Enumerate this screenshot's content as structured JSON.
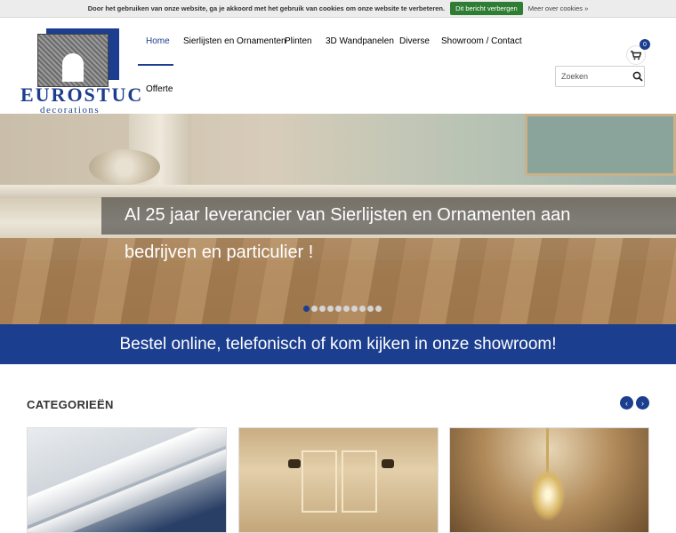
{
  "cookie": {
    "message": "Door het gebruiken van onze website, ga je akkoord met het gebruik van cookies om onze website te verbeteren.",
    "hide_button": "Dit bericht verbergen",
    "more_link": "Meer over cookies »"
  },
  "brand": {
    "name": "EUROSTUC",
    "tagline": "decorations",
    "primary_color": "#1c3e8e"
  },
  "nav": {
    "items": [
      {
        "label": "Home"
      },
      {
        "label": "Sierlijsten en Ornamenten"
      },
      {
        "label": "Plinten"
      },
      {
        "label": "3D Wandpanelen"
      },
      {
        "label": "Diverse"
      },
      {
        "label": "Showroom / Contact"
      },
      {
        "label": "Offerte"
      }
    ],
    "active": "Home"
  },
  "cart": {
    "count": "0",
    "icon": "cart-icon"
  },
  "search": {
    "placeholder": "Zoeken",
    "icon": "search-icon"
  },
  "hero": {
    "line1": "Al 25 jaar leverancier van Sierlijsten en Ornamenten aan",
    "line2": "bedrijven en particulier !",
    "slide_count": 10,
    "active_slide": 1
  },
  "banner": {
    "text": "Bestel online, telefonisch of kom kijken in onze showroom!"
  },
  "categories": {
    "title": "CATEGORIEËN",
    "prev_icon": "chevron-left-icon",
    "next_icon": "chevron-right-icon"
  }
}
